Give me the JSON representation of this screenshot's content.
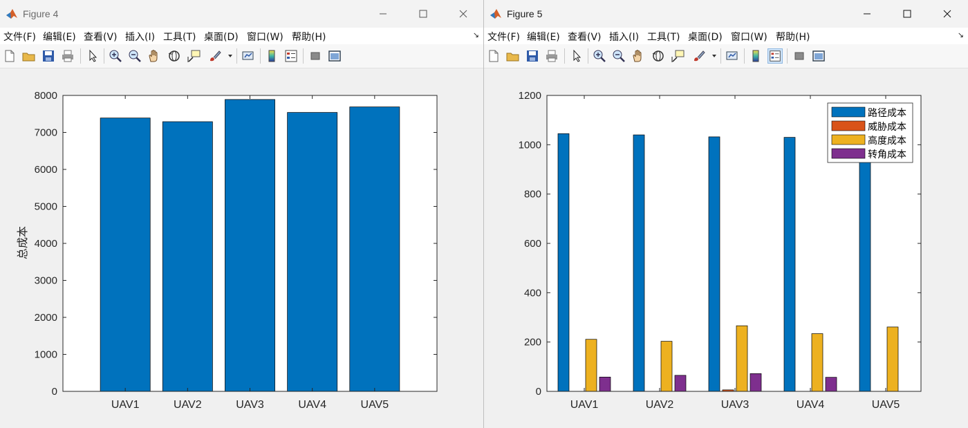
{
  "figure4": {
    "title": "Figure 4",
    "menu": [
      "文件(F)",
      "编辑(E)",
      "查看(V)",
      "插入(I)",
      "工具(T)",
      "桌面(D)",
      "窗口(W)",
      "帮助(H)"
    ],
    "chart_data": {
      "type": "bar",
      "categories": [
        "UAV1",
        "UAV2",
        "UAV3",
        "UAV4",
        "UAV5"
      ],
      "values": [
        7390,
        7290,
        7890,
        7540,
        7690
      ],
      "ylabel": "总成本",
      "ylim": [
        0,
        8000
      ],
      "yticks": [
        0,
        1000,
        2000,
        3000,
        4000,
        5000,
        6000,
        7000,
        8000
      ],
      "color": "#0072BD"
    }
  },
  "figure5": {
    "title": "Figure 5",
    "menu": [
      "文件(F)",
      "编辑(E)",
      "查看(V)",
      "插入(I)",
      "工具(T)",
      "桌面(D)",
      "窗口(W)",
      "帮助(H)"
    ],
    "chart_data": {
      "type": "bar",
      "categories": [
        "UAV1",
        "UAV2",
        "UAV3",
        "UAV4",
        "UAV5"
      ],
      "series": [
        {
          "name": "路径成本",
          "values": [
            1045,
            1040,
            1032,
            1030,
            1020
          ],
          "color": "#0072BD"
        },
        {
          "name": "威胁成本",
          "values": [
            0,
            0,
            6,
            0,
            0
          ],
          "color": "#D95319"
        },
        {
          "name": "高度成本",
          "values": [
            211,
            203,
            266,
            234,
            261
          ],
          "color": "#EDB120"
        },
        {
          "name": "转角成本",
          "values": [
            58,
            65,
            72,
            57,
            0
          ],
          "color": "#7E2F8E"
        }
      ],
      "ylim": [
        0,
        1200
      ],
      "yticks": [
        0,
        200,
        400,
        600,
        800,
        1000,
        1200
      ],
      "legend_position": "top-right"
    }
  }
}
